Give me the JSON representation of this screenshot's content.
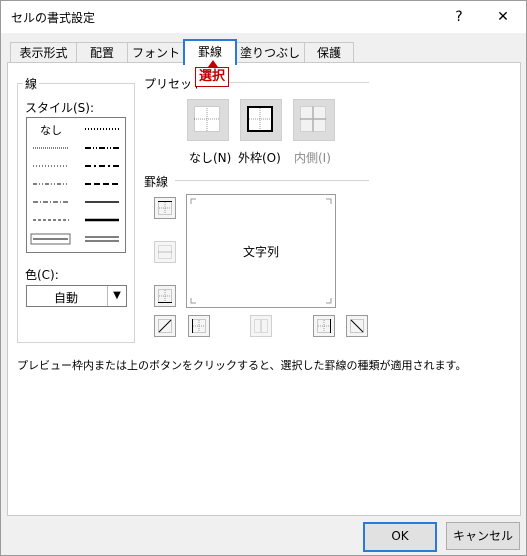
{
  "window": {
    "title": "セルの書式設定",
    "help_label": "?",
    "close_label": "✕"
  },
  "tabs": [
    {
      "label": "表示形式"
    },
    {
      "label": "配置"
    },
    {
      "label": "フォント"
    },
    {
      "label": "罫線"
    },
    {
      "label": "塗りつぶし"
    },
    {
      "label": "保護"
    }
  ],
  "active_tab": "罫線",
  "callout": {
    "label": "選択",
    "color": "#c00000"
  },
  "line_group": {
    "title": "線",
    "style_label": "スタイル(S):",
    "style_none": "なし",
    "color_label": "色(C):",
    "color_value": "自動"
  },
  "preset_group": {
    "title": "プリセット",
    "items": [
      {
        "label": "なし(N)"
      },
      {
        "label": "外枠(O)"
      },
      {
        "label": "内側(I)",
        "disabled": true
      }
    ]
  },
  "border_group": {
    "title": "罫線",
    "preview_text": "文字列"
  },
  "info_text": "プレビュー枠内または上のボタンをクリックすると、選択した罫線の種類が適用されます。",
  "buttons": {
    "ok": "OK",
    "cancel": "キャンセル"
  },
  "colors": {
    "accent": "#2b79d8",
    "callout": "#c00000"
  }
}
